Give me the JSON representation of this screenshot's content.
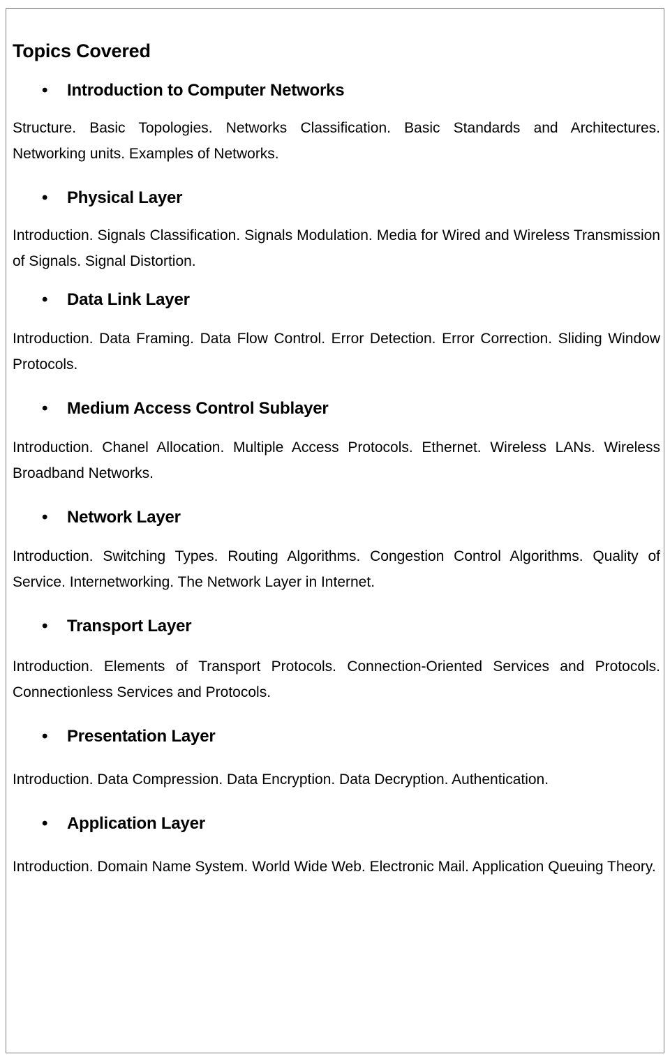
{
  "document": {
    "title": "Topics Covered",
    "bullet_glyph": "•",
    "sections": [
      {
        "heading": "Introduction to Computer Networks",
        "body": "Structure. Basic Topologies. Networks Classification. Basic Standards and Architectures. Networking units. Examples of Networks."
      },
      {
        "heading": "Physical Layer",
        "body": "Introduction. Signals Classification. Signals Modulation. Media for Wired and Wireless Transmission of Signals. Signal Distortion."
      },
      {
        "heading": "Data Link Layer",
        "body": "Introduction. Data Framing. Data Flow Control. Error Detection. Error Correction. Sliding Window Protocols."
      },
      {
        "heading": "Medium Access Control Sublayer",
        "body": "Introduction. Chanel Allocation. Multiple Access Protocols. Ethernet. Wireless LANs. Wireless Broadband Networks."
      },
      {
        "heading": "Network Layer",
        "body": "Introduction. Switching Types. Routing Algorithms. Congestion Control Algorithms. Quality of Service. Internetworking. The Network Layer in Internet."
      },
      {
        "heading": "Transport Layer",
        "body": "Introduction. Elements of Transport Protocols. Connection-Oriented Services and Protocols. Connectionless Services and Protocols."
      },
      {
        "heading": "Presentation Layer",
        "body": "Introduction. Data Compression. Data Encryption. Data Decryption. Authentication."
      },
      {
        "heading": "Application Layer",
        "body": "Introduction. Domain Name System. World Wide Web. Electronic Mail. Application Queuing Theory."
      }
    ]
  }
}
